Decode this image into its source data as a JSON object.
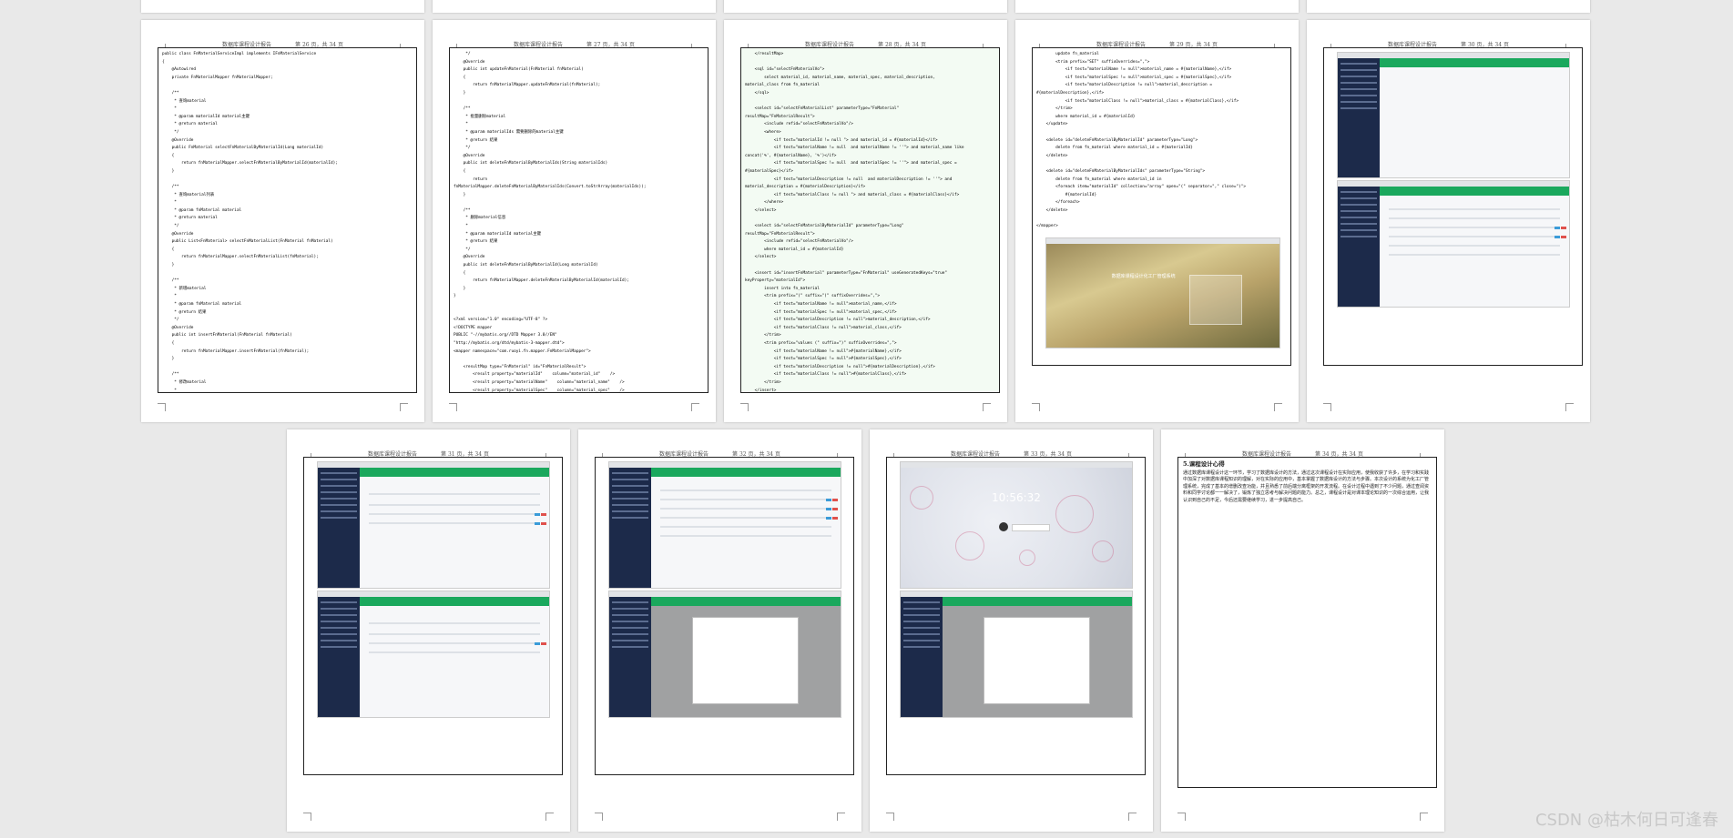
{
  "document": {
    "header_title": "数据库课程设计报告",
    "pages": [
      {
        "num": "第 26 页，共 34 页"
      },
      {
        "num": "第 27 页，共 34 页"
      },
      {
        "num": "第 28 页，共 34 页"
      },
      {
        "num": "第 29 页，共 34 页"
      },
      {
        "num": "第 30 页，共 34 页"
      },
      {
        "num": "第 31 页，共 34 页"
      },
      {
        "num": "第 32 页，共 34 页"
      },
      {
        "num": "第 33 页，共 34 页"
      },
      {
        "num": "第 34 页，共 34 页"
      }
    ],
    "code_p26": "public class FnMaterialServiceImpl implements IFnMaterialService\n{\n    @Autowired\n    private FnMaterialMapper fnMaterialMapper;\n\n    /**\n     * 查询material\n     *\n     * @param materialId material主键\n     * @return material\n     */\n    @Override\n    public FnMaterial selectFnMaterialByMaterialId(Long materialId)\n    {\n        return fnMaterialMapper.selectFnMaterialByMaterialId(materialId);\n    }\n\n    /**\n     * 查询material列表\n     *\n     * @param fnMaterial material\n     * @return material\n     */\n    @Override\n    public List<FnMaterial> selectFnMaterialList(FnMaterial fnMaterial)\n    {\n        return fnMaterialMapper.selectFnMaterialList(fnMaterial);\n    }\n\n    /**\n     * 新增material\n     *\n     * @param fnMaterial material\n     * @return 结果\n     */\n    @Override\n    public int insertFnMaterial(FnMaterial fnMaterial)\n    {\n        return fnMaterialMapper.insertFnMaterial(fnMaterial);\n    }\n\n    /**\n     * 修改material\n     *\n     * @param fnMaterial material\n     * @return 结果",
    "code_p27": "     */\n    @Override\n    public int updateFnMaterial(FnMaterial fnMaterial)\n    {\n        return fnMaterialMapper.updateFnMaterial(fnMaterial);\n    }\n\n    /**\n     * 批量删除material\n     *\n     * @param materialIds 需要删除的material主键\n     * @return 结果\n     */\n    @Override\n    public int deleteFnMaterialByMaterialIds(String materialIds)\n    {\n        return\nfnMaterialMapper.deleteFnMaterialByMaterialIds(Convert.toStrArray(materialIds));\n    }\n\n    /**\n     * 删除material信息\n     *\n     * @param materialId material主键\n     * @return 结果\n     */\n    @Override\n    public int deleteFnMaterialByMaterialId(Long materialId)\n    {\n        return fnMaterialMapper.deleteFnMaterialByMaterialId(materialId);\n    }\n}\n\n\n<?xml version=\"1.0\" encoding=\"UTF-8\" ?>\n<!DOCTYPE mapper\nPUBLIC \"-//mybatis.org//DTD Mapper 3.0//EN\"\n\"http://mybatis.org/dtd/mybatis-3-mapper.dtd\">\n<mapper namespace=\"com.ruoyi.fn.mapper.FnMaterialMapper\">\n\n    <resultMap type=\"FnMaterial\" id=\"FnMaterialResult\">\n        <result property=\"materialId\"    column=\"material_id\"    />\n        <result property=\"materialName\"    column=\"material_name\"    />\n        <result property=\"materialSpec\"    column=\"material_spec\"    />\n        <result property=\"materialDescription\"    column=\"material_description\"    />\n        <result property=\"materialClass\"    column=\"material_class\"    />",
    "code_p28": "    </resultMap>\n\n    <sql id=\"selectFnMaterialVo\">\n        select material_id, material_name, material_spec, material_description,\nmaterial_class from fn_material\n    </sql>\n\n    <select id=\"selectFnMaterialList\" parameterType=\"FnMaterial\"\nresultMap=\"FnMaterialResult\">\n        <include refid=\"selectFnMaterialVo\"/>\n        <where>\n            <if test=\"materialId != null \"> and material_id = #{materialId}</if>\n            <if test=\"materialName != null  and materialName != ''\"> and material_name like\nconcat('%', #{materialName}, '%')</if>\n            <if test=\"materialSpec != null  and materialSpec != ''\"> and material_spec =\n#{materialSpec}</if>\n            <if test=\"materialDescription != null  and materialDescription != ''\"> and\nmaterial_description = #{materialDescription}</if>\n            <if test=\"materialClass != null \"> and material_class = #{materialClass}</if>\n        </where>\n    </select>\n\n    <select id=\"selectFnMaterialByMaterialId\" parameterType=\"Long\"\nresultMap=\"FnMaterialResult\">\n        <include refid=\"selectFnMaterialVo\"/>\n        where material_id = #{materialId}\n    </select>\n\n    <insert id=\"insertFnMaterial\" parameterType=\"FnMaterial\" useGeneratedKeys=\"true\"\nkeyProperty=\"materialId\">\n        insert into fn_material\n        <trim prefix=\"(\" suffix=\")\" suffixOverrides=\",\">\n            <if test=\"materialName != null\">material_name,</if>\n            <if test=\"materialSpec != null\">material_spec,</if>\n            <if test=\"materialDescription != null\">material_description,</if>\n            <if test=\"materialClass != null\">material_class,</if>\n        </trim>\n        <trim prefix=\"values (\" suffix=\")\" suffixOverrides=\",\">\n            <if test=\"materialName != null\">#{materialName},</if>\n            <if test=\"materialSpec != null\">#{materialSpec},</if>\n            <if test=\"materialDescription != null\">#{materialDescription},</if>\n            <if test=\"materialClass != null\">#{materialClass},</if>\n        </trim>\n    </insert>\n\n    <update id=\"updateFnMaterial\" parameterType=\"FnMaterial\">",
    "code_p29": "        update fn_material\n        <trim prefix=\"SET\" suffixOverrides=\",\">\n            <if test=\"materialName != null\">material_name = #{materialName},</if>\n            <if test=\"materialSpec != null\">material_spec = #{materialSpec},</if>\n            <if test=\"materialDescription != null\">material_description =\n#{materialDescription},</if>\n            <if test=\"materialClass != null\">material_class = #{materialClass},</if>\n        </trim>\n        where material_id = #{materialId}\n    </update>\n\n    <delete id=\"deleteFnMaterialByMaterialId\" parameterType=\"Long\">\n        delete from fn_material where material_id = #{materialId}\n    </delete>\n\n    <delete id=\"deleteFnMaterialByMaterialIds\" parameterType=\"String\">\n        delete from fn_material where material_id in\n        <foreach item=\"materialId\" collection=\"array\" open=\"(\" separator=\",\" close=\")\">\n            #{materialId}\n        </foreach>\n    </delete>\n\n</mapper>",
    "login_title": "数据库课程设计化工厂管理系统",
    "lock_time": "10:56:32",
    "essay_heading": "5.课程设计心得",
    "essay_text": "通过数据库课程设计这一环节，学习了数据库设计的方法，通过这次课程设计在实际应用，使我收获了许多，在学习和实践中加深了对数据库课程知识的理解，对在实际的应用中，基本掌握了数据库设计的方法与步骤。本次设计的系统为化工厂管理系统，完成了基本的增删改查功能，并且熟悉了前后端分离框架的开发流程。在设计过程中遇到了不少问题，通过查阅资料和同学讨论都一一解决了，锻炼了独立思考与解决问题的能力。总之，课程设计是对课本理论知识的一次综合运用，让我认识到自己的不足，今后还需要继续学习，进一步提高自己。"
  },
  "watermark": "CSDN @枯木何日可逢春"
}
